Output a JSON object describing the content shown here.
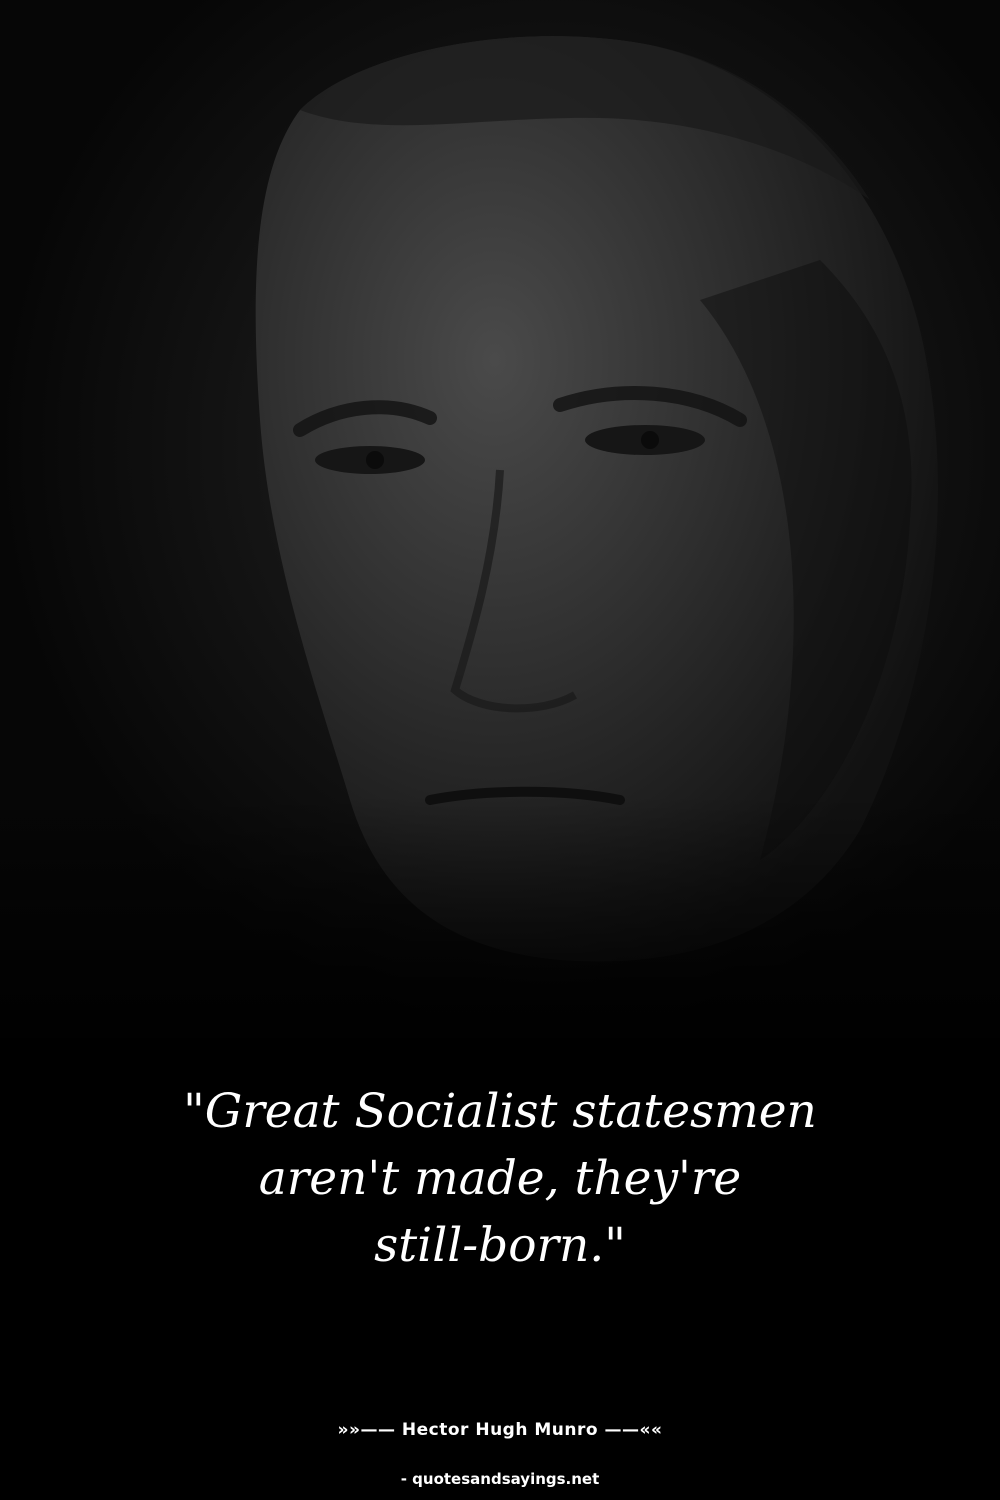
{
  "quote": {
    "text": "\"Great Socialist statesmen\naren't made, they're\nstill-born.\""
  },
  "author": {
    "line": "»»—— Hector Hugh Munro ——««"
  },
  "source": {
    "text": "- quotesandsayings.net"
  },
  "colors": {
    "background": "#000000",
    "text": "#ffffff"
  }
}
